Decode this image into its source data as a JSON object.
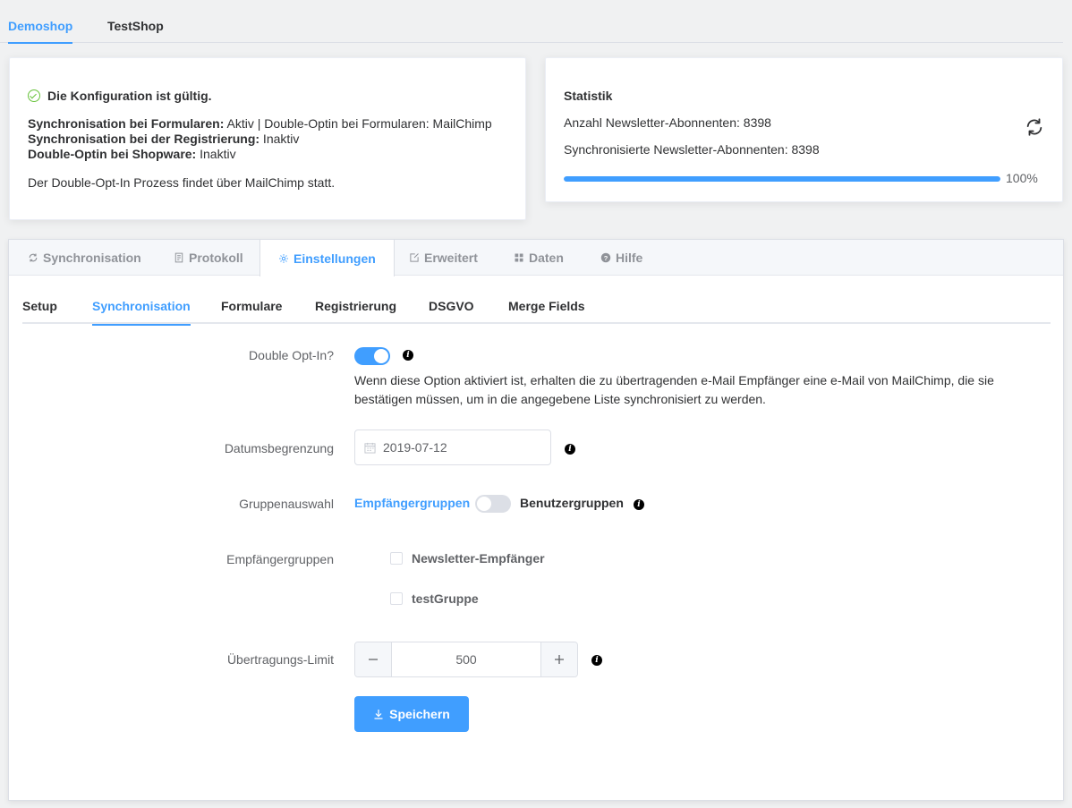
{
  "shop_tabs": [
    {
      "label": "Demoshop",
      "active": true
    },
    {
      "label": "TestShop",
      "active": false
    }
  ],
  "config": {
    "title": "Die Konfiguration ist gültig.",
    "line1_label": "Synchronisation bei Formularen:",
    "line1_value": " Aktiv | Double-Optin bei Formularen: MailChimp",
    "line2_label": "Synchronisation bei der Registrierung:",
    "line2_value": " Inaktiv",
    "line3_label": "Double-Optin bei Shopware:",
    "line3_value": " Inaktiv",
    "note": "Der Double-Opt-In Prozess findet über MailChimp statt."
  },
  "stats": {
    "title": "Statistik",
    "subscribers": "Anzahl Newsletter-Abonnenten: 8398",
    "synced": "Synchronisierte Newsletter-Abonnenten: 8398",
    "progress": 100,
    "progress_label": "100%"
  },
  "main_tabs": [
    {
      "label": "Synchronisation",
      "icon": "refresh-icon"
    },
    {
      "label": "Protokoll",
      "icon": "document-icon"
    },
    {
      "label": "Einstellungen",
      "icon": "gear-icon",
      "active": true
    },
    {
      "label": "Erweitert",
      "icon": "edit-icon"
    },
    {
      "label": "Daten",
      "icon": "grid-icon"
    },
    {
      "label": "Hilfe",
      "icon": "question-icon"
    }
  ],
  "sub_tabs": [
    {
      "label": "Setup"
    },
    {
      "label": "Synchronisation",
      "active": true
    },
    {
      "label": "Formulare"
    },
    {
      "label": "Registrierung"
    },
    {
      "label": "DSGVO"
    },
    {
      "label": "Merge Fields"
    }
  ],
  "form": {
    "double_optin_label": "Double Opt-In?",
    "double_optin_on": true,
    "double_optin_desc": "Wenn diese Option aktiviert ist, erhalten die zu übertragenden e-Mail Empfänger eine e-Mail von MailChimp, die sie bestätigen müssen, um in die angegebene Liste synchronisiert zu werden.",
    "date_label": "Datumsbegrenzung",
    "date_value": "2019-07-12",
    "group_label": "Gruppenauswahl",
    "group_left": "Empfängergruppen",
    "group_right": "Benutzergruppen",
    "group_switch_on": false,
    "recipients_label": "Empfängergruppen",
    "recipient_groups": [
      "Newsletter-Empfänger",
      "testGruppe"
    ],
    "limit_label": "Übertragungs-Limit",
    "limit_value": "500",
    "save_label": "Speichern"
  },
  "colors": {
    "accent": "#409eff",
    "success": "#67c23a"
  }
}
